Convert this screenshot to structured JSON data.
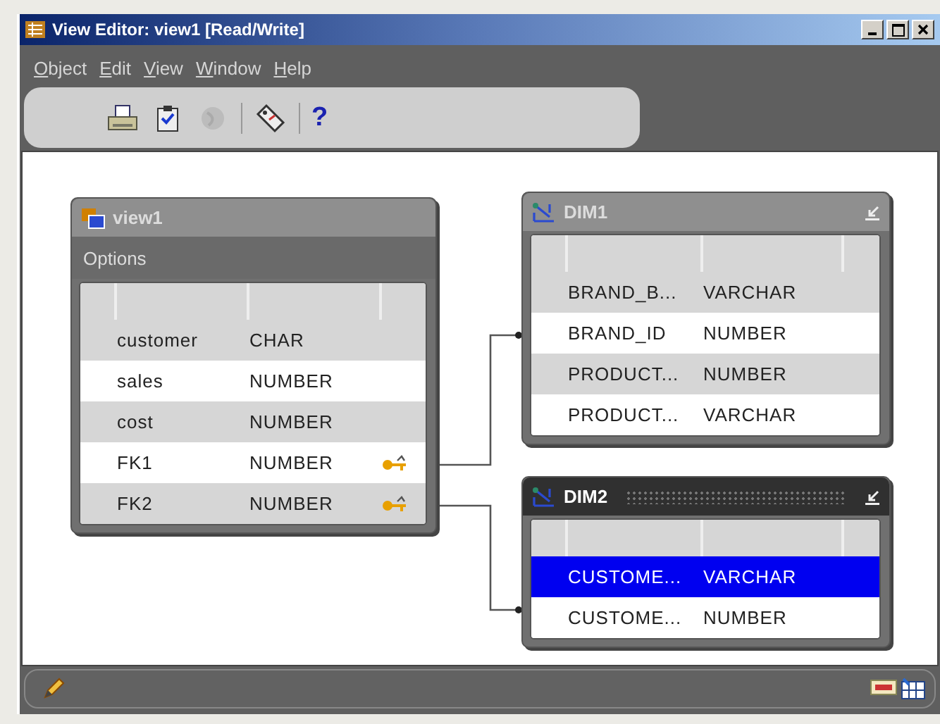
{
  "window": {
    "title": "View Editor: view1 [Read/Write]"
  },
  "menu": [
    "Object",
    "Edit",
    "View",
    "Window",
    "Help"
  ],
  "toolbar": [
    {
      "kind": "button",
      "disabled": false
    },
    {
      "kind": "button",
      "disabled": false
    },
    {
      "kind": "button",
      "disabled": true
    },
    {
      "kind": "separator"
    },
    {
      "kind": "button",
      "disabled": false
    },
    {
      "kind": "separator"
    },
    {
      "kind": "glyph",
      "text": "?",
      "disabled": false
    }
  ],
  "nodes": [
    {
      "title": "view1",
      "active": false,
      "options": "Options",
      "rows": [
        {
          "name": "customer",
          "type": "CHAR",
          "key": false,
          "selected": false
        },
        {
          "name": "sales",
          "type": "NUMBER",
          "key": false,
          "selected": false
        },
        {
          "name": "cost",
          "type": "NUMBER",
          "key": false,
          "selected": false
        },
        {
          "name": "FK1",
          "type": "NUMBER",
          "key": true,
          "selected": false
        },
        {
          "name": "FK2",
          "type": "NUMBER",
          "key": true,
          "selected": false
        }
      ]
    },
    {
      "title": "DIM1",
      "active": false,
      "rows": [
        {
          "name": "BRAND_B...",
          "type": "VARCHAR",
          "key": false,
          "selected": false
        },
        {
          "name": "BRAND_ID",
          "type": "NUMBER",
          "key": false,
          "selected": false
        },
        {
          "name": "PRODUCT...",
          "type": "NUMBER",
          "key": false,
          "selected": false
        },
        {
          "name": "PRODUCT...",
          "type": "VARCHAR",
          "key": false,
          "selected": false
        }
      ]
    },
    {
      "title": "DIM2",
      "active": true,
      "rows": [
        {
          "name": "CUSTOME...",
          "type": "VARCHAR",
          "key": false,
          "selected": true
        },
        {
          "name": "CUSTOME...",
          "type": "NUMBER",
          "key": false,
          "selected": false
        }
      ]
    }
  ]
}
